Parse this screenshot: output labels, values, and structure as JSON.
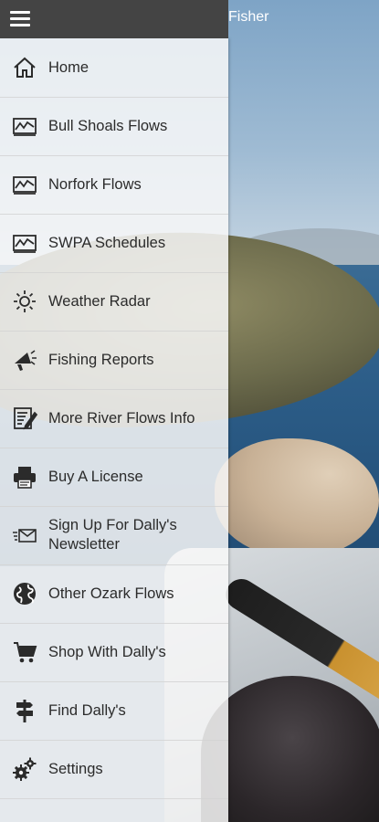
{
  "header": {
    "app_title": "Fisher"
  },
  "menu": {
    "items": [
      {
        "label": "Home",
        "icon": "home-icon"
      },
      {
        "label": "Bull Shoals Flows",
        "icon": "chart-icon"
      },
      {
        "label": "Norfork Flows",
        "icon": "chart-icon"
      },
      {
        "label": "SWPA Schedules",
        "icon": "chart-icon"
      },
      {
        "label": "Weather Radar",
        "icon": "sun-icon"
      },
      {
        "label": "Fishing Reports",
        "icon": "megaphone-icon"
      },
      {
        "label": "More River Flows Info",
        "icon": "edit-note-icon"
      },
      {
        "label": "Buy A License",
        "icon": "printer-icon"
      },
      {
        "label": "Sign Up For Dally's\nNewsletter",
        "icon": "mail-icon"
      },
      {
        "label": "Other Ozark Flows",
        "icon": "globe-icon"
      },
      {
        "label": "Shop With Dally's",
        "icon": "cart-icon"
      },
      {
        "label": "Find Dally's",
        "icon": "signpost-icon"
      },
      {
        "label": "Settings",
        "icon": "gears-icon"
      }
    ]
  },
  "colors": {
    "drawer_bg": "#f8f8f8",
    "topbar": "#444444",
    "text": "#2b2b2b"
  }
}
